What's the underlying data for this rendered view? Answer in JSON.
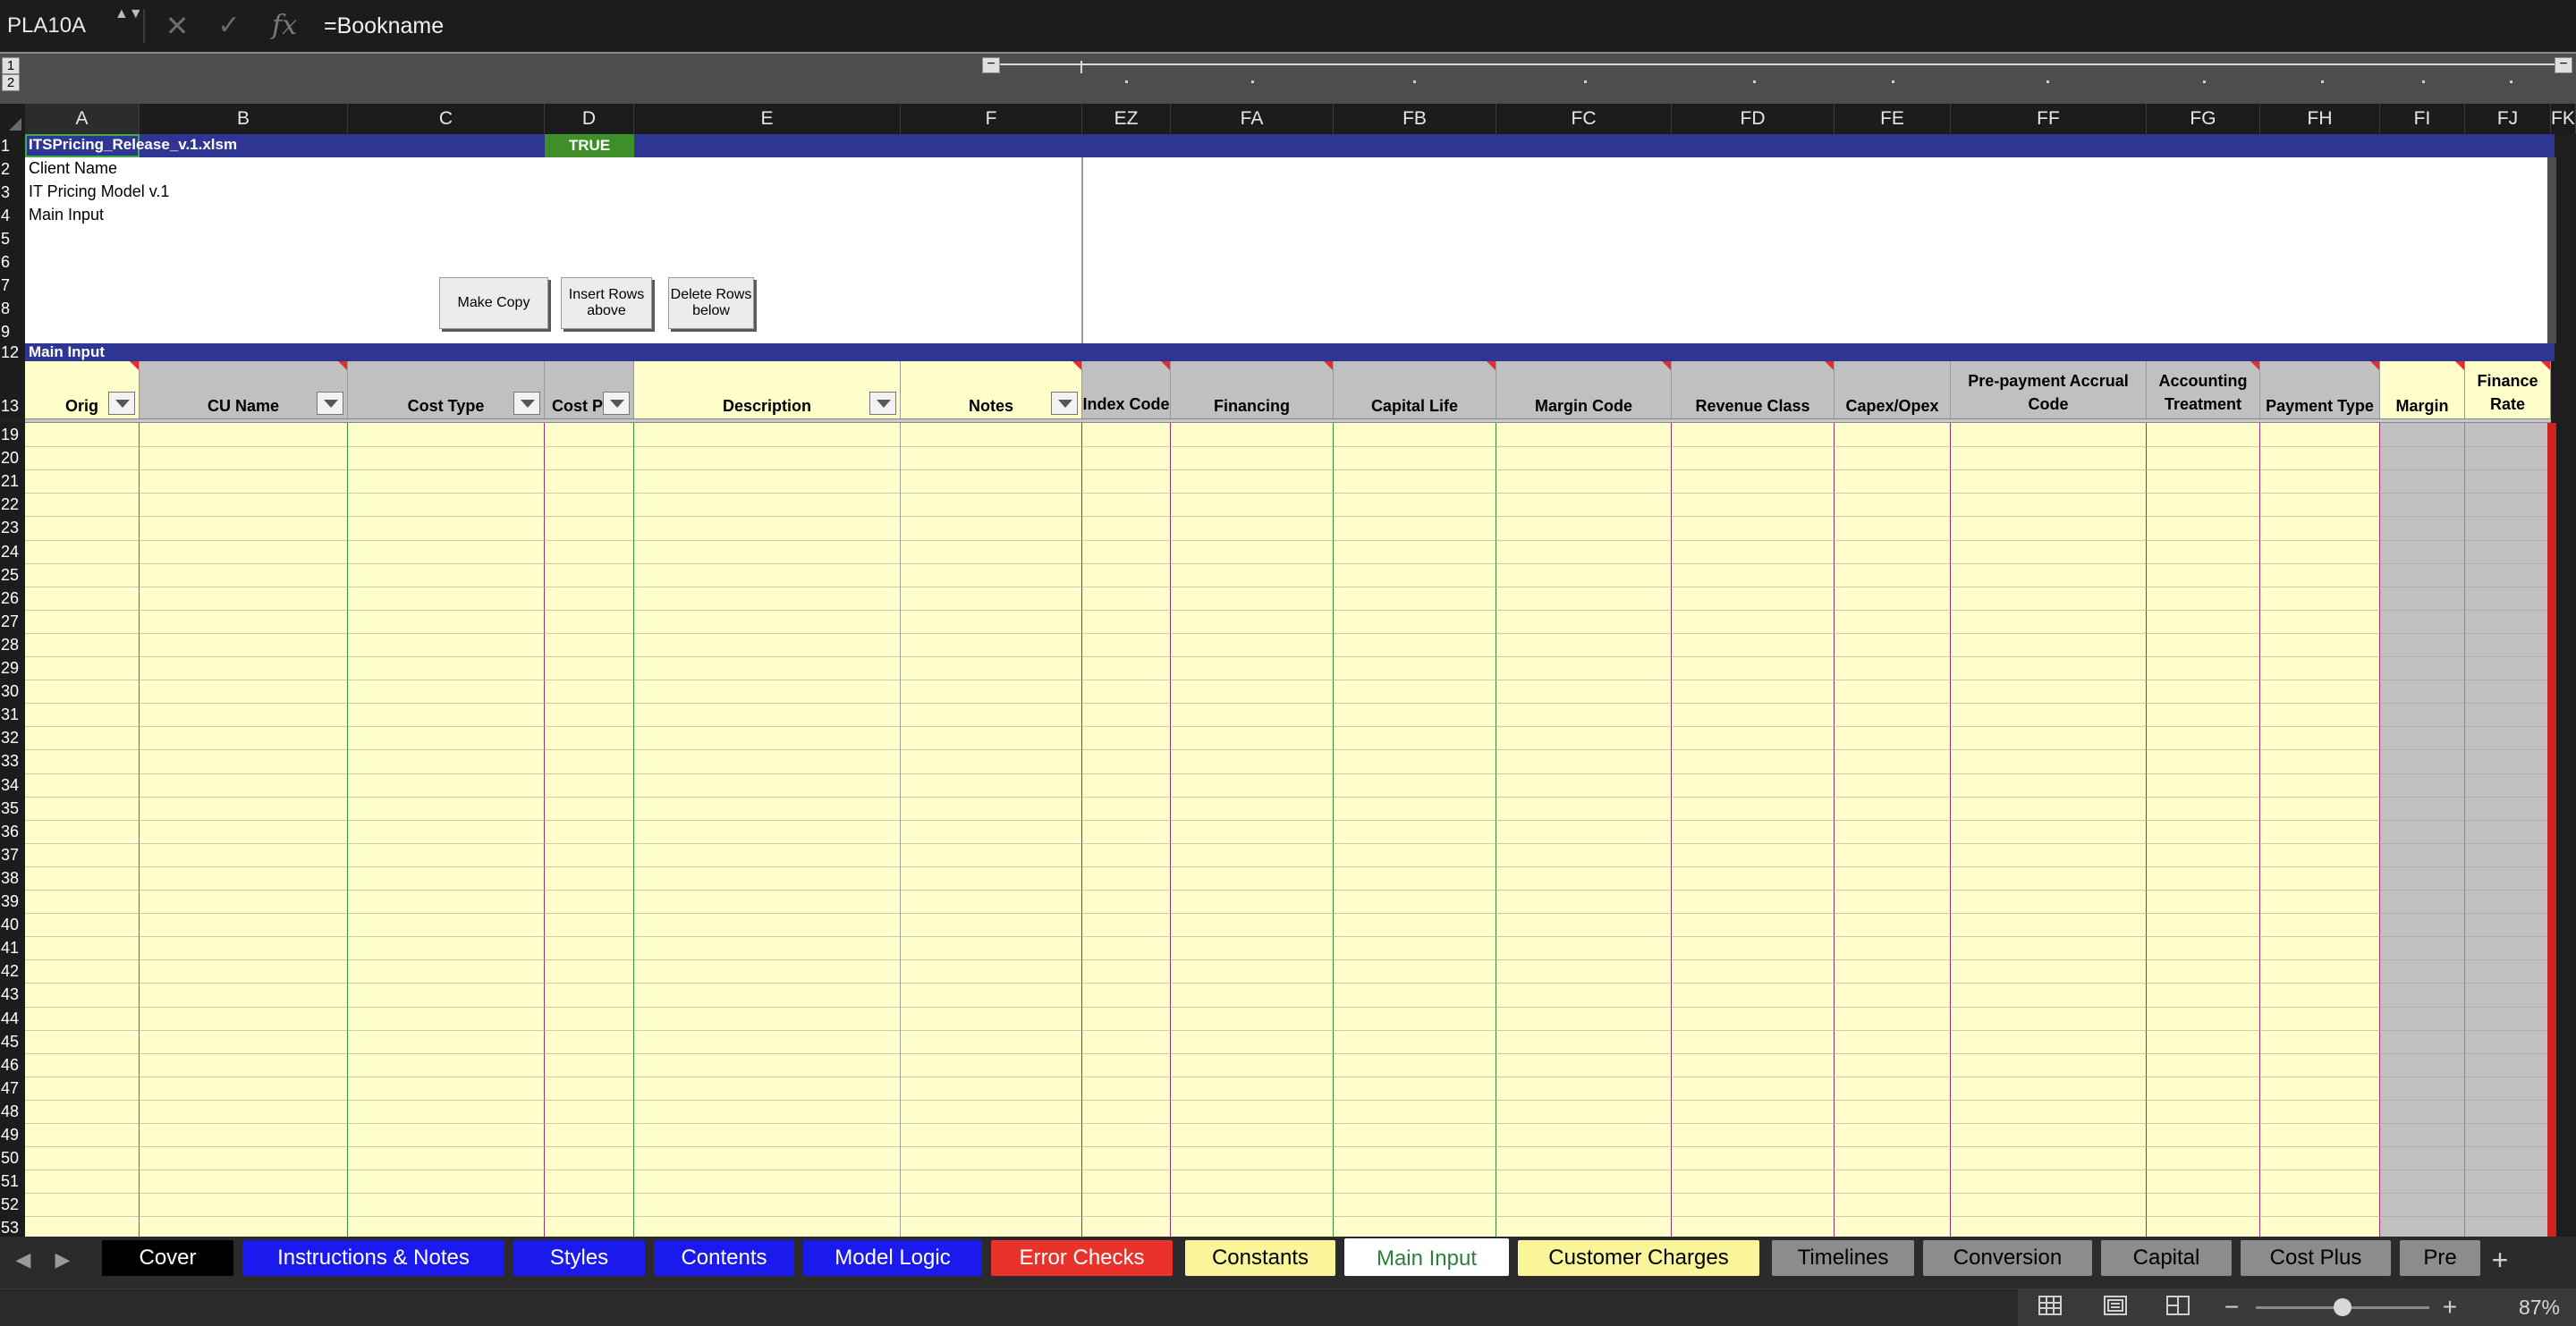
{
  "formula_bar": {
    "name_box": "PLA10A",
    "name_box_arrows": "▲▼",
    "cancel_icon": "✕",
    "enter_icon": "✓",
    "fx_label": "fx",
    "formula": "=Bookname"
  },
  "outline": {
    "levels": [
      "1",
      "2"
    ],
    "collapse_symbol": "−"
  },
  "columns": [
    "A",
    "B",
    "C",
    "D",
    "E",
    "F",
    "EZ",
    "FA",
    "FB",
    "FC",
    "FD",
    "FE",
    "FF",
    "FG",
    "FH",
    "FI",
    "FJ",
    "FK"
  ],
  "rows_top": [
    "1",
    "2",
    "3",
    "4",
    "5",
    "6",
    "7",
    "8",
    "9",
    "12",
    "13"
  ],
  "rows_data": [
    "19",
    "20",
    "21",
    "22",
    "23",
    "24",
    "25",
    "26",
    "27",
    "28",
    "29",
    "30",
    "31",
    "32",
    "33",
    "34",
    "35",
    "36",
    "37",
    "38",
    "39",
    "40",
    "41",
    "42",
    "43",
    "44",
    "45",
    "46",
    "47",
    "48",
    "49",
    "50",
    "51",
    "52",
    "53"
  ],
  "cells": {
    "a1": "ITSPricing_Release_v.1.xlsm",
    "d1": "TRUE",
    "a2": "Client Name",
    "a3": "IT Pricing Model v.1",
    "a4": "Main Input",
    "a12": "Main Input"
  },
  "buttons": {
    "make_copy": "Make Copy",
    "insert_rows": "Insert Rows above",
    "delete_rows": "Delete Rows below"
  },
  "table_headers": {
    "orig": "Orig",
    "cu_name": "CU Name",
    "cost_type": "Cost Type",
    "cost_ph": "Cost Ph",
    "description": "Description",
    "notes": "Notes",
    "index_code": "Index Code",
    "financing": "Financing",
    "capital_life": "Capital Life",
    "margin_code": "Margin Code",
    "revenue_class": "Revenue Class",
    "capex_opex": "Capex/Opex",
    "prepayment": "Pre-payment Accrual Code",
    "accounting": "Accounting Treatment",
    "payment_type": "Payment Type",
    "margin": "Margin",
    "finance_rate": "Finance Rate"
  },
  "tabs": [
    {
      "label": "Cover",
      "bg": "#000000",
      "fg": "#ffffff"
    },
    {
      "label": "Instructions & Notes",
      "bg": "#1a1aee",
      "fg": "#ffffff"
    },
    {
      "label": "Styles",
      "bg": "#1a1aee",
      "fg": "#ffffff"
    },
    {
      "label": "Contents",
      "bg": "#1a1aee",
      "fg": "#ffffff"
    },
    {
      "label": "Model Logic",
      "bg": "#1a1aee",
      "fg": "#ffffff"
    },
    {
      "label": "Error Checks",
      "bg": "#e8322a",
      "fg": "#ffffff"
    },
    {
      "label": "Constants",
      "bg": "#fbf59a",
      "fg": "#000000"
    },
    {
      "label": "Main Input",
      "bg": "#ffffff",
      "fg": "#2f7f3a",
      "active": true
    },
    {
      "label": "Customer Charges",
      "bg": "#fbf59a",
      "fg": "#000000"
    },
    {
      "label": "Timelines",
      "bg": "#8c8c8c",
      "fg": "#000000"
    },
    {
      "label": "Conversion",
      "bg": "#8c8c8c",
      "fg": "#000000"
    },
    {
      "label": "Capital",
      "bg": "#8c8c8c",
      "fg": "#000000"
    },
    {
      "label": "Cost Plus",
      "bg": "#8c8c8c",
      "fg": "#000000"
    },
    {
      "label": "Pre",
      "bg": "#8c8c8c",
      "fg": "#000000"
    }
  ],
  "tab_nav": {
    "prev": "◀",
    "next": "▶",
    "add": "+"
  },
  "status": {
    "normal_view_icon": "grid-view-icon",
    "page_layout_icon": "page-layout-icon",
    "page_break_icon": "page-break-icon",
    "zoom_out": "−",
    "zoom_in": "+",
    "zoom_level": "87%",
    "zoom_fraction": 0.5
  },
  "colors": {
    "navy_band": "#2e3592",
    "true_green": "#3e8e2a",
    "input_yellow": "#ffffcc",
    "header_gray": "#c0c0c0",
    "header_yellow": "#ffffcc"
  }
}
